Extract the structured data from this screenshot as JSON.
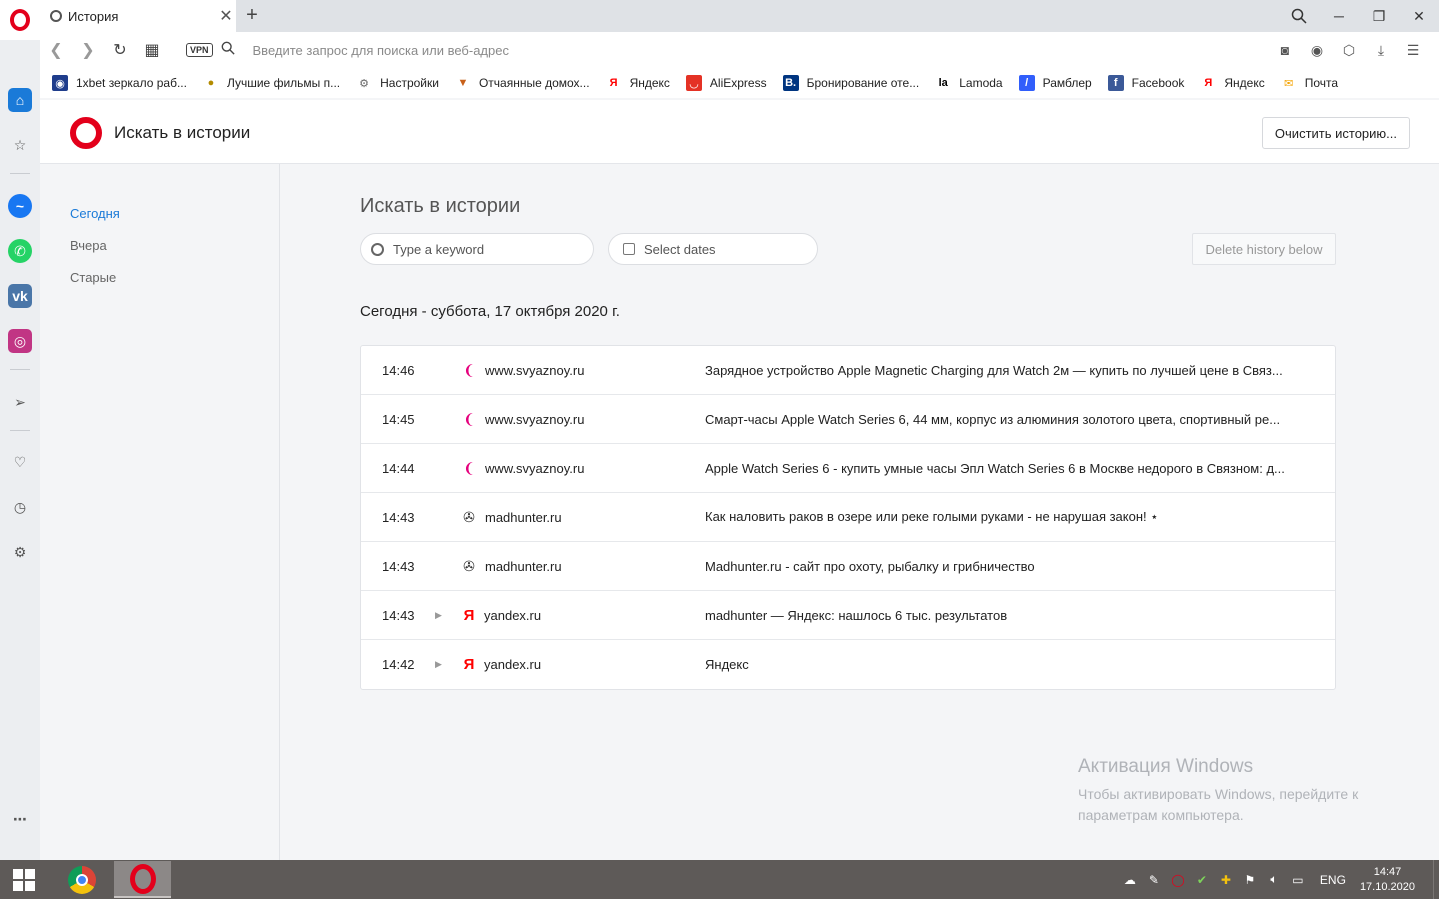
{
  "browser": {
    "tab": {
      "title": "История"
    },
    "address": {
      "placeholder": "Введите запрос для поиска или веб-адрес"
    },
    "vpn_label": "VPN",
    "bookmarks": [
      {
        "label": "1xbet зеркало раб...",
        "icon": "1xbet-icon",
        "color": "#1f3d8c"
      },
      {
        "label": "Лучшие фильмы п...",
        "icon": "film-icon",
        "color": "#b38b00"
      },
      {
        "label": "Настройки",
        "icon": "gear-icon",
        "color": "#666666"
      },
      {
        "label": "Отчаянные домох...",
        "icon": "fox-icon",
        "color": "#c8611a"
      },
      {
        "label": "Яндекс",
        "icon": "yandex-icon",
        "color": "#ff0000"
      },
      {
        "label": "AliExpress",
        "icon": "aliexpress-icon",
        "color": "#e43225"
      },
      {
        "label": "Бронирование оте...",
        "icon": "booking-icon",
        "color": "#003580"
      },
      {
        "label": "Lamoda",
        "icon": "lamoda-icon",
        "color": "#000000"
      },
      {
        "label": "Рамблер",
        "icon": "rambler-icon",
        "color": "#315efb"
      },
      {
        "label": "Facebook",
        "icon": "facebook-icon",
        "color": "#3b5998"
      },
      {
        "label": "Яндекс",
        "icon": "yandex-icon",
        "color": "#ff0000"
      },
      {
        "label": "Почта",
        "icon": "mail-icon",
        "color": "#f5a300"
      }
    ]
  },
  "history_page": {
    "header_title": "Искать в истории",
    "clear_button": "Очистить историю...",
    "nav": {
      "today": "Сегодня",
      "yesterday": "Вчера",
      "older": "Старые"
    },
    "main_title": "Искать в истории",
    "keyword_placeholder": "Type a keyword",
    "dates_label": "Select dates",
    "delete_below": "Delete history below",
    "day_heading": "Сегодня - суббота, 17 октября 2020 г.",
    "accent_color": "#1a7ad8",
    "entries": [
      {
        "time": "14:46",
        "domain": "www.svyaznoy.ru",
        "icon": "svyaznoy-icon",
        "expandable": false,
        "title": "Зарядное устройство Apple Magnetic Charging для Watch 2м — купить по лучшей цене в Связ..."
      },
      {
        "time": "14:45",
        "domain": "www.svyaznoy.ru",
        "icon": "svyaznoy-icon",
        "expandable": false,
        "title": "Смарт-часы Apple Watch Series 6, 44 мм, корпус из алюминия золотого цвета, спортивный ре..."
      },
      {
        "time": "14:44",
        "domain": "www.svyaznoy.ru",
        "icon": "svyaznoy-icon",
        "expandable": false,
        "title": "Apple Watch Series 6 - купить умные часы Эпл Watch Series 6 в Москве недорого в Связном: д..."
      },
      {
        "time": "14:43",
        "domain": "madhunter.ru",
        "icon": "madhunter-icon",
        "expandable": false,
        "title": "Как наловить раков в озере или реке голыми руками - не нарушая закон! ⋆"
      },
      {
        "time": "14:43",
        "domain": "madhunter.ru",
        "icon": "madhunter-icon",
        "expandable": false,
        "title": "Madhunter.ru - сайт про охоту, рыбалку и грибничество"
      },
      {
        "time": "14:43",
        "domain": "yandex.ru",
        "icon": "yandex-icon",
        "expandable": true,
        "title": "madhunter — Яндекс: нашлось 6 тыс. результатов"
      },
      {
        "time": "14:42",
        "domain": "yandex.ru",
        "icon": "yandex-icon",
        "expandable": true,
        "title": "Яндекс"
      }
    ]
  },
  "watermark": {
    "title": "Активация Windows",
    "text": "Чтобы активировать Windows, перейдите к параметрам компьютера."
  },
  "taskbar": {
    "language": "ENG",
    "time": "14:47",
    "date": "17.10.2020"
  }
}
